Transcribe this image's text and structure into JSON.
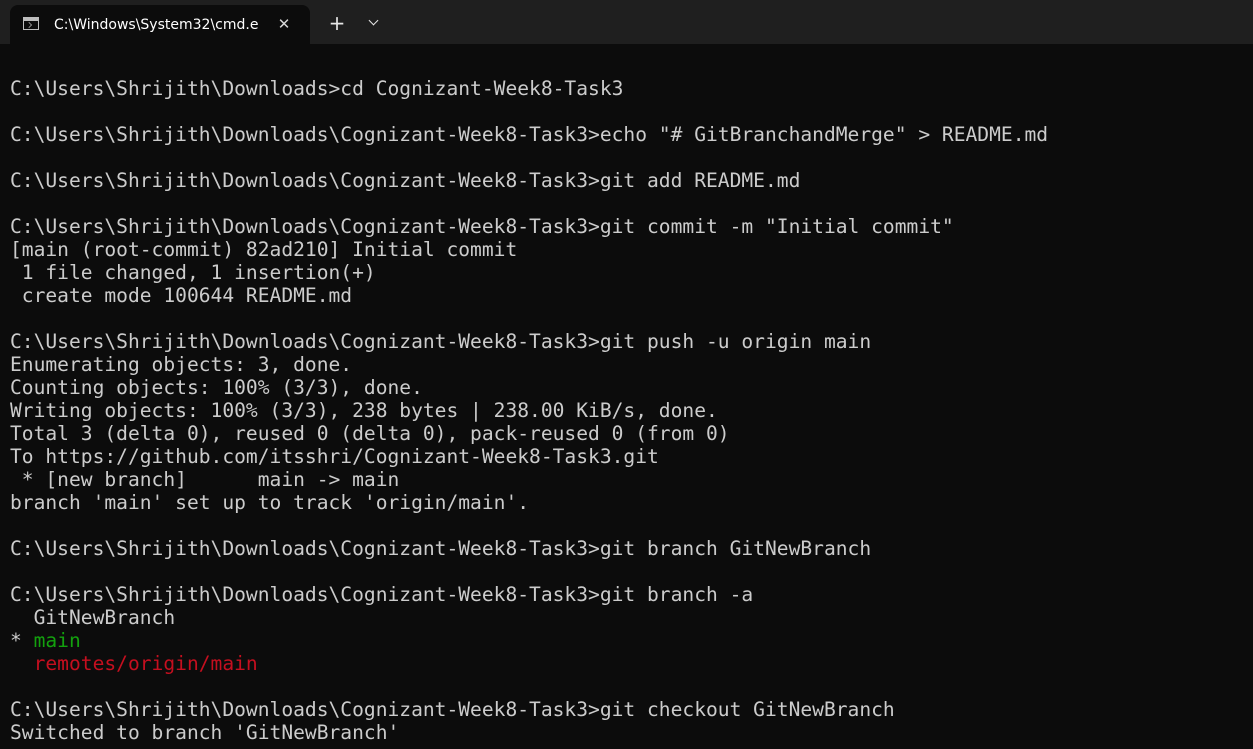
{
  "window": {
    "tab_title": "C:\\Windows\\System32\\cmd.e",
    "close_glyph": "✕",
    "new_tab_glyph": "+"
  },
  "colors": {
    "background": "#0c0c0c",
    "titlebar": "#1f1f1f",
    "text": "#cccccc",
    "branch_current": "#13a10e",
    "branch_remote": "#c50f1f"
  },
  "icons": {
    "tab": "console-icon",
    "close": "close-icon",
    "new_tab": "plus-icon",
    "dropdown": "chevron-down-icon"
  },
  "terminal": {
    "lines": [
      {
        "text": "",
        "color": "default"
      },
      {
        "text": "C:\\Users\\Shrijith\\Downloads>cd Cognizant-Week8-Task3",
        "color": "default"
      },
      {
        "text": "",
        "color": "default"
      },
      {
        "text": "C:\\Users\\Shrijith\\Downloads\\Cognizant-Week8-Task3>echo \"# GitBranchandMerge\" > README.md",
        "color": "default"
      },
      {
        "text": "",
        "color": "default"
      },
      {
        "text": "C:\\Users\\Shrijith\\Downloads\\Cognizant-Week8-Task3>git add README.md",
        "color": "default"
      },
      {
        "text": "",
        "color": "default"
      },
      {
        "text": "C:\\Users\\Shrijith\\Downloads\\Cognizant-Week8-Task3>git commit -m \"Initial commit\"",
        "color": "default"
      },
      {
        "text": "[main (root-commit) 82ad210] Initial commit",
        "color": "default"
      },
      {
        "text": " 1 file changed, 1 insertion(+)",
        "color": "default"
      },
      {
        "text": " create mode 100644 README.md",
        "color": "default"
      },
      {
        "text": "",
        "color": "default"
      },
      {
        "text": "C:\\Users\\Shrijith\\Downloads\\Cognizant-Week8-Task3>git push -u origin main",
        "color": "default"
      },
      {
        "text": "Enumerating objects: 3, done.",
        "color": "default"
      },
      {
        "text": "Counting objects: 100% (3/3), done.",
        "color": "default"
      },
      {
        "text": "Writing objects: 100% (3/3), 238 bytes | 238.00 KiB/s, done.",
        "color": "default"
      },
      {
        "text": "Total 3 (delta 0), reused 0 (delta 0), pack-reused 0 (from 0)",
        "color": "default"
      },
      {
        "text": "To https://github.com/itsshri/Cognizant-Week8-Task3.git",
        "color": "default"
      },
      {
        "text": " * [new branch]      main -> main",
        "color": "default"
      },
      {
        "text": "branch 'main' set up to track 'origin/main'.",
        "color": "default"
      },
      {
        "text": "",
        "color": "default"
      },
      {
        "text": "C:\\Users\\Shrijith\\Downloads\\Cognizant-Week8-Task3>git branch GitNewBranch",
        "color": "default"
      },
      {
        "text": "",
        "color": "default"
      },
      {
        "text": "C:\\Users\\Shrijith\\Downloads\\Cognizant-Week8-Task3>git branch -a",
        "color": "default"
      },
      {
        "text": "  GitNewBranch",
        "color": "default"
      },
      {
        "text": "* ",
        "color": "default",
        "suffix": "main",
        "suffix_color": "green"
      },
      {
        "text": "  ",
        "color": "default",
        "suffix": "remotes/origin/main",
        "suffix_color": "red"
      },
      {
        "text": "",
        "color": "default"
      },
      {
        "text": "C:\\Users\\Shrijith\\Downloads\\Cognizant-Week8-Task3>git checkout GitNewBranch",
        "color": "default"
      },
      {
        "text": "Switched to branch 'GitNewBranch'",
        "color": "default"
      }
    ]
  }
}
